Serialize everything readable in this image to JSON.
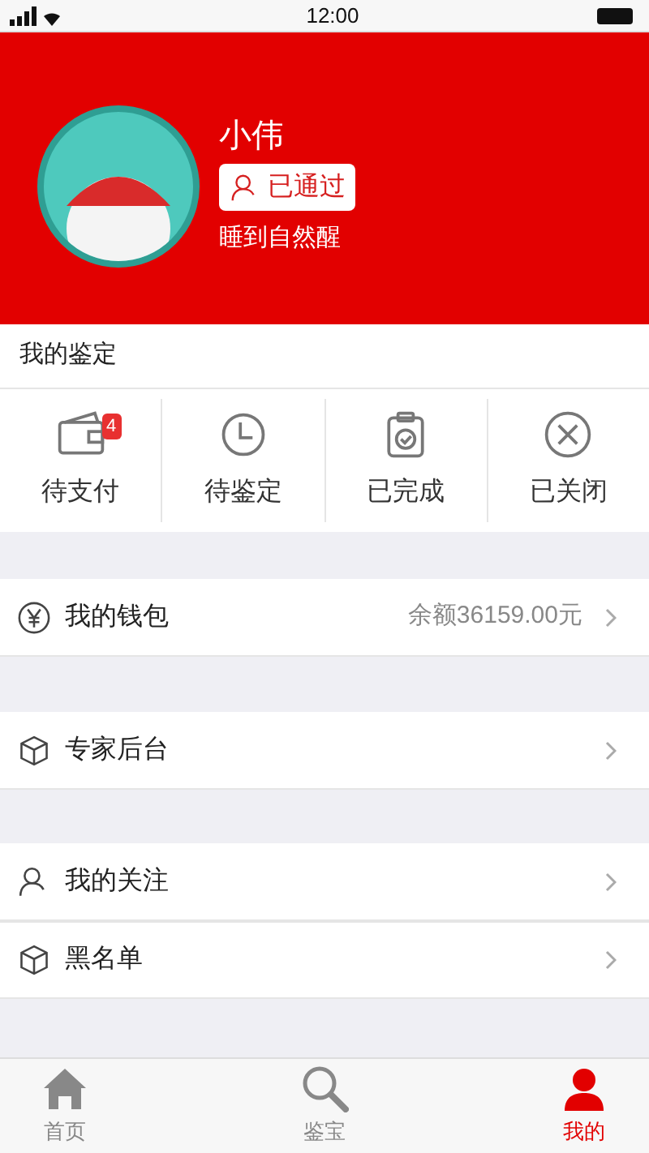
{
  "status_bar": {
    "time": "12:00"
  },
  "profile": {
    "name": "小伟",
    "badge": "已通过",
    "motto": "睡到自然醒"
  },
  "appraisal": {
    "title": "我的鉴定",
    "orders": [
      {
        "kind": "wallet",
        "label": "待支付",
        "count": "4"
      },
      {
        "kind": "clock",
        "label": "待鉴定"
      },
      {
        "kind": "clipboard",
        "label": "已完成"
      },
      {
        "kind": "close",
        "label": "已关闭"
      }
    ]
  },
  "menu_groups": [
    [
      {
        "kind": "yuan",
        "label": "我的钱包",
        "value": "余额36159.00元"
      }
    ],
    [
      {
        "kind": "box",
        "label": "专家后台"
      }
    ],
    [
      {
        "kind": "person",
        "label": "我的关注"
      },
      {
        "kind": "box",
        "label": "黑名单"
      }
    ]
  ],
  "tab_bar": [
    {
      "kind": "home",
      "label": "首页",
      "selected": false
    },
    {
      "kind": "search",
      "label": "鉴宝",
      "selected": false
    },
    {
      "kind": "person",
      "label": "我的",
      "selected": true
    }
  ]
}
